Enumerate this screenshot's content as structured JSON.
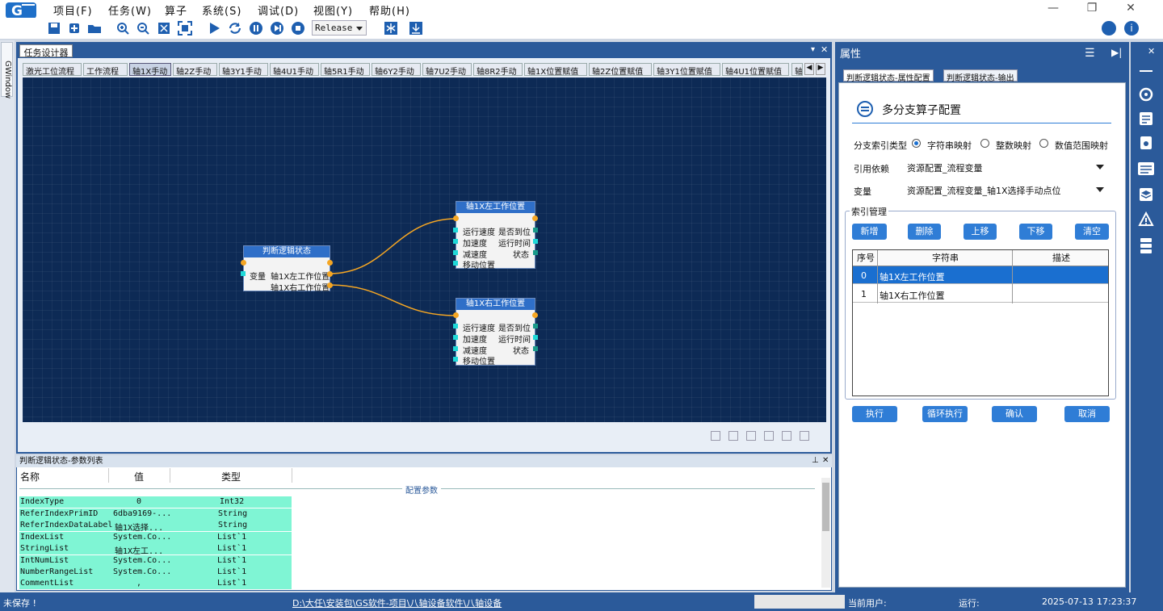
{
  "menu": [
    "项目(F)",
    "任务(W)",
    "算子",
    "系统(S)",
    "调试(D)",
    "视图(Y)",
    "帮助(H)"
  ],
  "toolbar": {
    "config": "Release"
  },
  "left_strip_label": "GWindow",
  "designer": {
    "tab": "任务设计器",
    "subtabs": [
      "激光工位流程",
      "工作流程",
      "轴1X手动",
      "轴2Z手动",
      "轴3Y1手动",
      "轴4U1手动",
      "轴5R1手动",
      "轴6Y2手动",
      "轴7U2手动",
      "轴8R2手动",
      "轴1X位置赋值",
      "轴2Z位置赋值",
      "轴3Y1位置赋值",
      "轴4U1位置赋值",
      "轴"
    ],
    "active_subtab": "轴1X手动",
    "node_judge": {
      "title": "判断逻辑状态",
      "input": "变量",
      "out1": "轴1X左工作位置",
      "out2": "轴1X右工作位置"
    },
    "node_left": {
      "title": "轴1X左工作位置",
      "rows": [
        [
          "运行速度",
          "是否到位"
        ],
        [
          "加速度",
          "运行时间"
        ],
        [
          "减速度",
          "状态"
        ],
        [
          "移动位置",
          ""
        ]
      ]
    },
    "node_right": {
      "title": "轴1X右工作位置",
      "rows": [
        [
          "运行速度",
          "是否到位"
        ],
        [
          "加速度",
          "运行时间"
        ],
        [
          "减速度",
          "状态"
        ],
        [
          "移动位置",
          ""
        ]
      ]
    }
  },
  "params": {
    "title": "判断逻辑状态-参数列表",
    "headers": [
      "名称",
      "值",
      "类型"
    ],
    "section": "配置参数",
    "rows": [
      [
        "IndexType",
        "0",
        "Int32"
      ],
      [
        "ReferIndexPrimID",
        "6dba9169-...",
        "String"
      ],
      [
        "ReferIndexDataLabel",
        "轴1X选择...",
        "String"
      ],
      [
        "IndexList",
        "System.Co...",
        "List`1"
      ],
      [
        "StringList",
        "轴1X左工...",
        "List`1"
      ],
      [
        "IntNumList",
        "System.Co...",
        "List`1"
      ],
      [
        "NumberRangeList",
        "System.Co...",
        "List`1"
      ],
      [
        "CommentList",
        ",",
        "List`1"
      ]
    ]
  },
  "props": {
    "title": "属性",
    "tabs": [
      "判断逻辑状态-属性配置",
      "判断逻辑状态-输出"
    ],
    "heading": "多分支算子配置",
    "branch_type_label": "分支索引类型",
    "radios": [
      "字符串映射",
      "整数映射",
      "数值范围映射"
    ],
    "refer_label": "引用依赖",
    "refer_value": "资源配置_流程变量",
    "var_label": "变量",
    "var_value": "资源配置_流程变量_轴1X选择手动点位",
    "index_group": "索引管理",
    "index_buttons": [
      "新增",
      "删除",
      "上移",
      "下移",
      "清空"
    ],
    "grid_headers": [
      "序号",
      "字符串",
      "描述"
    ],
    "grid_rows": [
      [
        "0",
        "轴1X左工作位置",
        ""
      ],
      [
        "1",
        "轴1X右工作位置",
        ""
      ]
    ],
    "bottom_buttons": [
      "执行",
      "循环执行",
      "确认",
      "取消"
    ]
  },
  "status": {
    "save": "未保存 !",
    "path": "D:\\大任\\安装包\\GS软件-项目\\八轴设备软件\\八轴设备",
    "user_label": "当前用户:",
    "run_label": "运行:",
    "date": "2025-07-13",
    "time": "17:23:37"
  }
}
